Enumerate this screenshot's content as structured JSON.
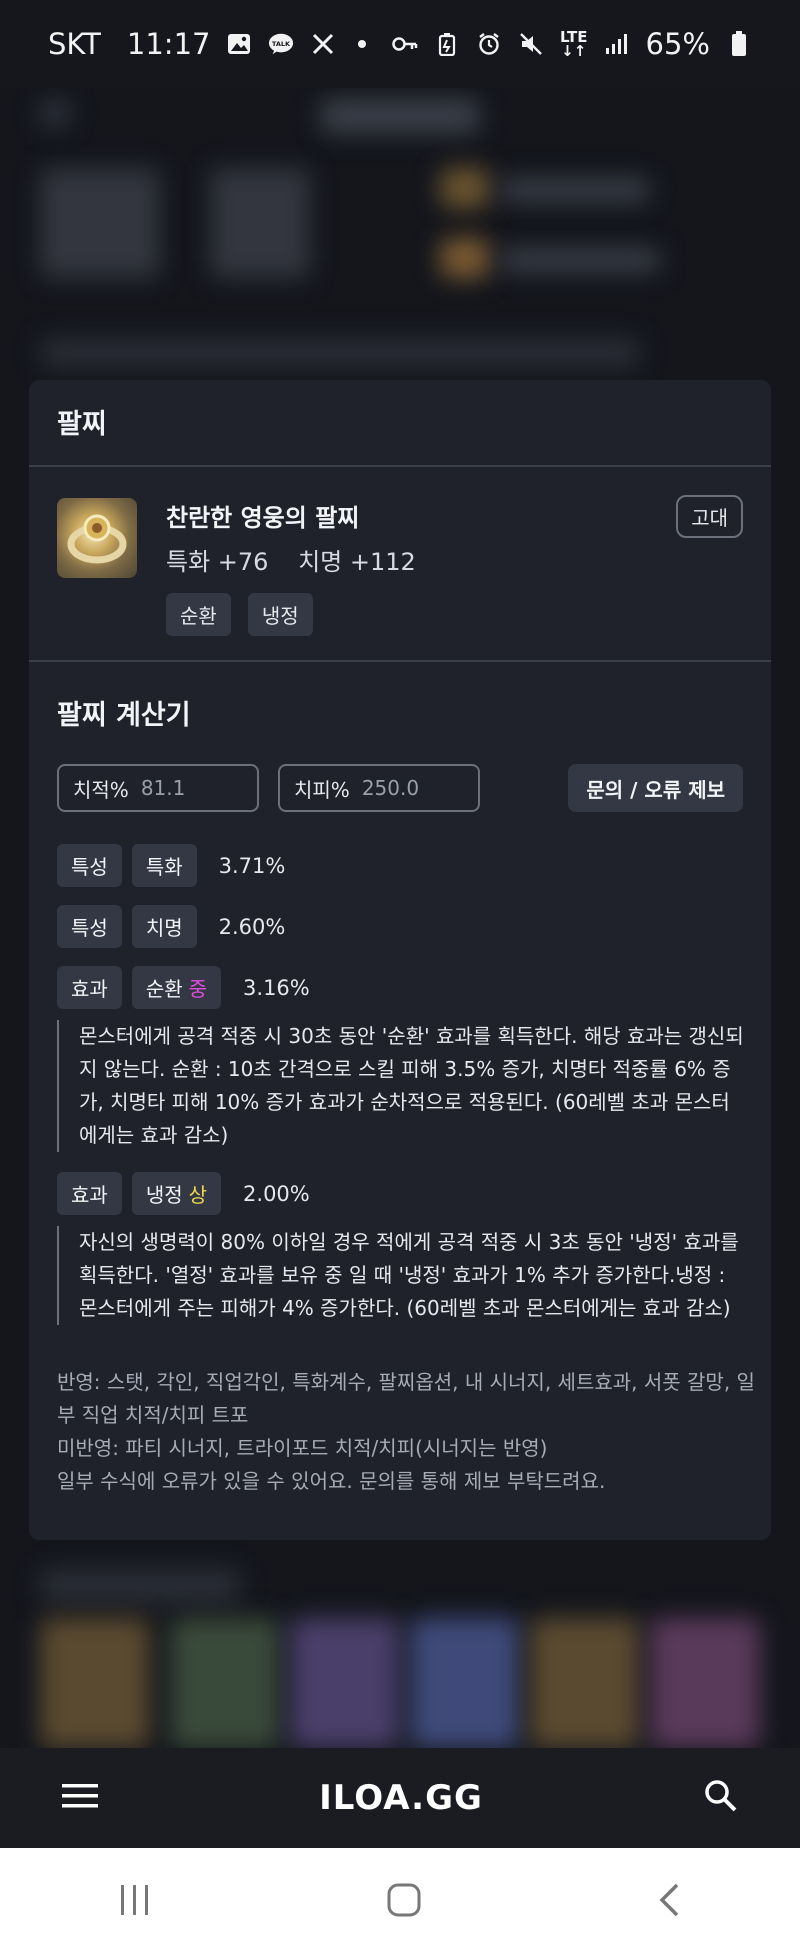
{
  "status_bar": {
    "carrier": "SKT",
    "time": "11:17",
    "battery": "65%",
    "network": "LTE"
  },
  "panel": {
    "title": "팔찌",
    "item": {
      "name": "찬란한 영웅의 팔찌",
      "stats": [
        "특화 +76",
        "치명 +112"
      ],
      "grade": "고대",
      "tags": [
        "순환",
        "냉정"
      ]
    },
    "calculator": {
      "title": "팔찌 계산기",
      "crit_rate_label": "치적%",
      "crit_rate_value": "81.1",
      "crit_dmg_label": "치피%",
      "crit_dmg_value": "250.0",
      "report_button": "문의 / 오류 제보",
      "rows": [
        {
          "type": "특성",
          "name": "특화",
          "grade": "",
          "value": "3.71%"
        },
        {
          "type": "특성",
          "name": "치명",
          "grade": "",
          "value": "2.60%"
        },
        {
          "type": "효과",
          "name": "순환",
          "grade": "중",
          "value": "3.16%",
          "desc": "몬스터에게 공격 적중 시 30초 동안 '순환' 효과를 획득한다. 해당 효과는 갱신되지 않는다. 순환 : 10초 간격으로 스킬 피해 3.5% 증가, 치명타 적중률 6% 증가, 치명타 피해 10% 증가 효과가 순차적으로 적용된다. (60레벨 초과 몬스터에게는 효과 감소)"
        },
        {
          "type": "효과",
          "name": "냉정",
          "grade": "상",
          "value": "2.00%",
          "desc": "자신의 생명력이 80% 이하일 경우 적에게 공격 적중 시 3초 동안 '냉정' 효과를 획득한다. '열정' 효과를 보유 중 일 때 '냉정' 효과가 1% 추가 증가한다.냉정 : 몬스터에게 주는 피해가 4% 증가한다. (60레벨 초과 몬스터에게는 효과 감소)"
        }
      ],
      "notes": [
        "반영: 스탯, 각인, 직업각인, 특화계수, 팔찌옵션, 내 시너지, 세트효과, 서폿 갈망, 일부 직업 치적/치피 트포",
        "미반영: 파티 시너지, 트라이포드 치적/치피(시너지는 반영)",
        "일부 수식에 오류가 있을 수 있어요. 문의를 통해 제보 부탁드려요."
      ]
    }
  },
  "app_bar": {
    "logo": "ILOA.GG",
    "menu_icon": "hamburger-icon",
    "search_icon": "search-icon"
  },
  "system_nav": {
    "recents_icon": "recents-icon",
    "home_icon": "home-icon",
    "back_icon": "back-icon"
  }
}
